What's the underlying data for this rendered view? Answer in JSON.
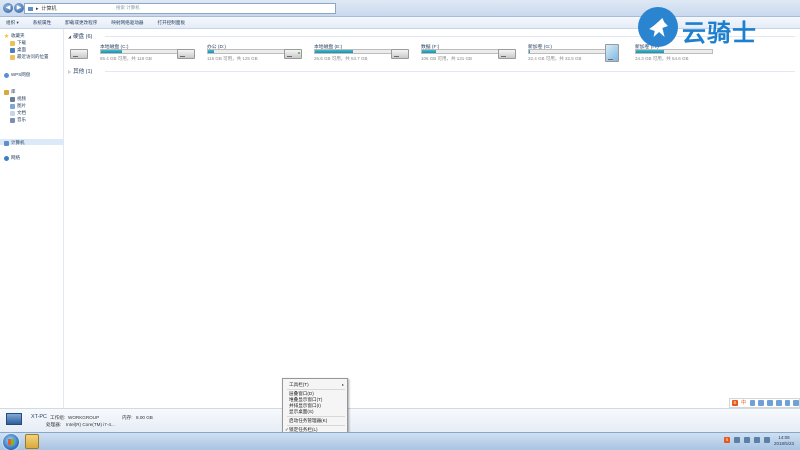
{
  "window": {
    "address": {
      "segment": "计算机",
      "arrow": "▸",
      "search_placeholder": "搜索 计算机"
    }
  },
  "toolbar": {
    "items": [
      "组织 ▾",
      "系统属性",
      "卸载或更改程序",
      "映射网络驱动器",
      "打开控制面板"
    ]
  },
  "nav": {
    "favorites": {
      "label": "收藏夹",
      "items": [
        "下载",
        "桌面",
        "最近访问的位置"
      ]
    },
    "wps": "WPS网盘",
    "libraries": {
      "label": "库",
      "items": [
        "视频",
        "图片",
        "文档",
        "音乐"
      ]
    },
    "computer": "计算机",
    "network": "网络"
  },
  "main": {
    "group_disks": "硬盘 (6)",
    "group_other": "其他 (1)",
    "drives": [
      {
        "name": "本地磁盘 (C:)",
        "info": "85.4 GB 可用，共 118 GB",
        "used": 0.28,
        "icon": "hdd"
      },
      {
        "name": "办公 (D:)",
        "info": "115 GB 可用，共 125 GB",
        "used": 0.08,
        "icon": "hdd"
      },
      {
        "name": "本地磁盘 (E:)",
        "info": "26.6 GB 可用，共 53.7 GB",
        "used": 0.5,
        "icon": "hdd-usb"
      },
      {
        "name": "数据 (F:)",
        "info": "106 GB 可用，共 131 GB",
        "used": 0.19,
        "icon": "hdd"
      },
      {
        "name": "新加卷 (G:)",
        "info": "32.4 GB 可用，共 32.5 GB",
        "used": 0.01,
        "icon": "hdd"
      },
      {
        "name": "新加卷 (H:)",
        "info": "34.3 GB 可用，共 54.6 GB",
        "used": 0.37,
        "icon": "windows-drive"
      }
    ]
  },
  "details": {
    "pc_name": "XT-PC",
    "workgroup_label": "工作组:",
    "workgroup": "WORKGROUP",
    "memory_label": "内存:",
    "memory": "8.00 GB",
    "processor_label": "处理器:",
    "processor": "Intel(R) Core(TM) i7-4..."
  },
  "context_menu": {
    "items": [
      "工具栏(T)",
      "层叠窗口(D)",
      "堆叠显示窗口(T)",
      "并排显示窗口(I)",
      "显示桌面(S)",
      "启动任务管理器(K)",
      "锁定任务栏(L)",
      "属性(R)"
    ],
    "arrow": "▸",
    "check": "✓"
  },
  "ime": {
    "logo": "S",
    "mode": "中"
  },
  "tray": {
    "ime": "S",
    "time": "14:08",
    "date": "2018/5/23"
  },
  "logo": {
    "text": "云骑士"
  },
  "colors": {
    "drive_fill": "#1d8fa8",
    "selection": "#dce9f8",
    "accent": "#2a84cf"
  }
}
